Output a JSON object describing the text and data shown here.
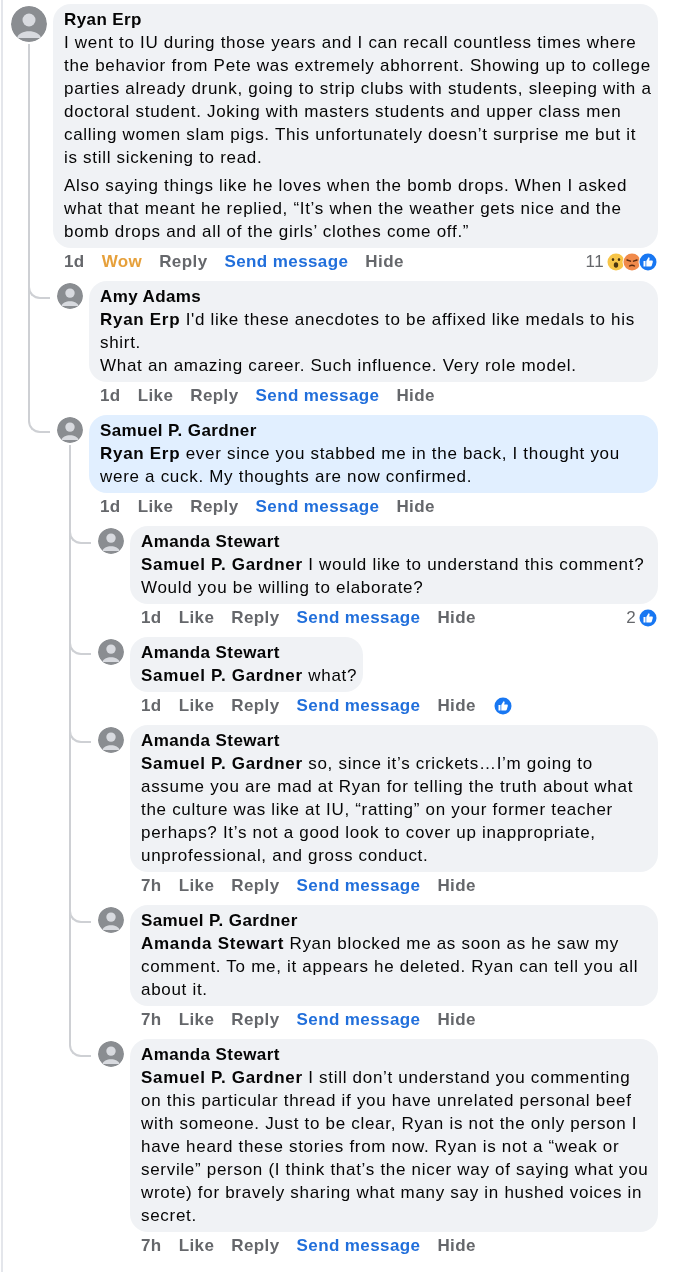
{
  "comments": [
    {
      "author": "Ryan Erp",
      "highlighted": false,
      "paragraphs": [
        "I went to IU during those years and I can recall countless times where the behavior from Pete was extremely abhorrent. Showing up to college parties already drunk, going to strip clubs with students, sleeping with a doctoral student. Joking with masters students and upper class men calling women slam pigs. This unfortunately doesn’t surprise me but it is still sickening to read.",
        "Also saying things like he loves when the bomb drops. When I asked what that meant he replied, “It’s when the weather gets nice and the bomb drops and all of the girls’ clothes come off.”"
      ],
      "time": "1d",
      "like": {
        "label": "Wow",
        "selected": true,
        "kind": "wow"
      },
      "reply": "Reply",
      "message": "Send message",
      "hide": "Hide",
      "reactions": {
        "count": "11",
        "icons": [
          {
            "kind": "wow"
          },
          {
            "kind": "angry"
          },
          {
            "kind": "like"
          }
        ]
      },
      "children": [
        {
          "author": "Amy Adams",
          "highlighted": false,
          "paragraphs": [
            "**Ryan Erp** I'd like these anecdotes to be affixed like medals to his shirt.\nWhat an amazing career. Such influence. Very role model."
          ],
          "time": "1d",
          "like": {
            "label": "Like",
            "selected": false
          },
          "reply": "Reply",
          "message": "Send message",
          "hide": "Hide"
        },
        {
          "author": "Samuel P. Gardner",
          "highlighted": true,
          "paragraphs": [
            "**Ryan Erp** ever since you stabbed me in the back, I thought you were a cuck. My thoughts are now confirmed."
          ],
          "time": "1d",
          "like": {
            "label": "Like",
            "selected": false
          },
          "reply": "Reply",
          "message": "Send message",
          "hide": "Hide",
          "children": [
            {
              "author": "Amanda Stewart",
              "highlighted": false,
              "paragraphs": [
                "**Samuel P. Gardner** I would like to understand this comment? Would you be willing to elaborate?"
              ],
              "time": "1d",
              "like": {
                "label": "Like",
                "selected": false
              },
              "reply": "Reply",
              "message": "Send message",
              "hide": "Hide",
              "reactions": {
                "count": "2",
                "icons": [
                  {
                    "kind": "like"
                  }
                ]
              }
            },
            {
              "author": "Amanda Stewart",
              "highlighted": false,
              "paragraphs": [
                "**Samuel P. Gardner** what?"
              ],
              "time": "1d",
              "like": {
                "label": "Like",
                "selected": false
              },
              "reply": "Reply",
              "message": "Send message",
              "hide": "Hide",
              "reactions": {
                "icons": [
                  {
                    "kind": "like"
                  }
                ]
              }
            },
            {
              "author": "Amanda Stewart",
              "highlighted": false,
              "paragraphs": [
                "**Samuel P. Gardner** so, since it’s crickets…I’m going to assume you are mad at Ryan for telling the truth about what the culture was like at IU, “ratting” on your former teacher perhaps? It’s not a good look to cover up inappropriate, unprofessional, and gross conduct."
              ],
              "time": "7h",
              "like": {
                "label": "Like",
                "selected": false
              },
              "reply": "Reply",
              "message": "Send message",
              "hide": "Hide"
            },
            {
              "author": "Samuel P. Gardner",
              "highlighted": false,
              "paragraphs": [
                "**Amanda Stewart** Ryan blocked me as soon as he saw my comment. To me, it appears he deleted. Ryan can tell you all about it."
              ],
              "time": "7h",
              "like": {
                "label": "Like",
                "selected": false
              },
              "reply": "Reply",
              "message": "Send message",
              "hide": "Hide"
            },
            {
              "author": "Amanda Stewart",
              "highlighted": false,
              "paragraphs": [
                "**Samuel P. Gardner** I still don’t understand you commenting on this particular thread if you have unrelated personal beef with someone. Just to be clear, Ryan is not the only person I have heard these stories from now. Ryan is not a “weak or servile” person (I think that’s the nicer way of saying what you wrote) for bravely sharing what many say in hushed voices in secret."
              ],
              "time": "7h",
              "like": {
                "label": "Like",
                "selected": false
              },
              "reply": "Reply",
              "message": "Send message",
              "hide": "Hide"
            }
          ]
        }
      ]
    }
  ]
}
